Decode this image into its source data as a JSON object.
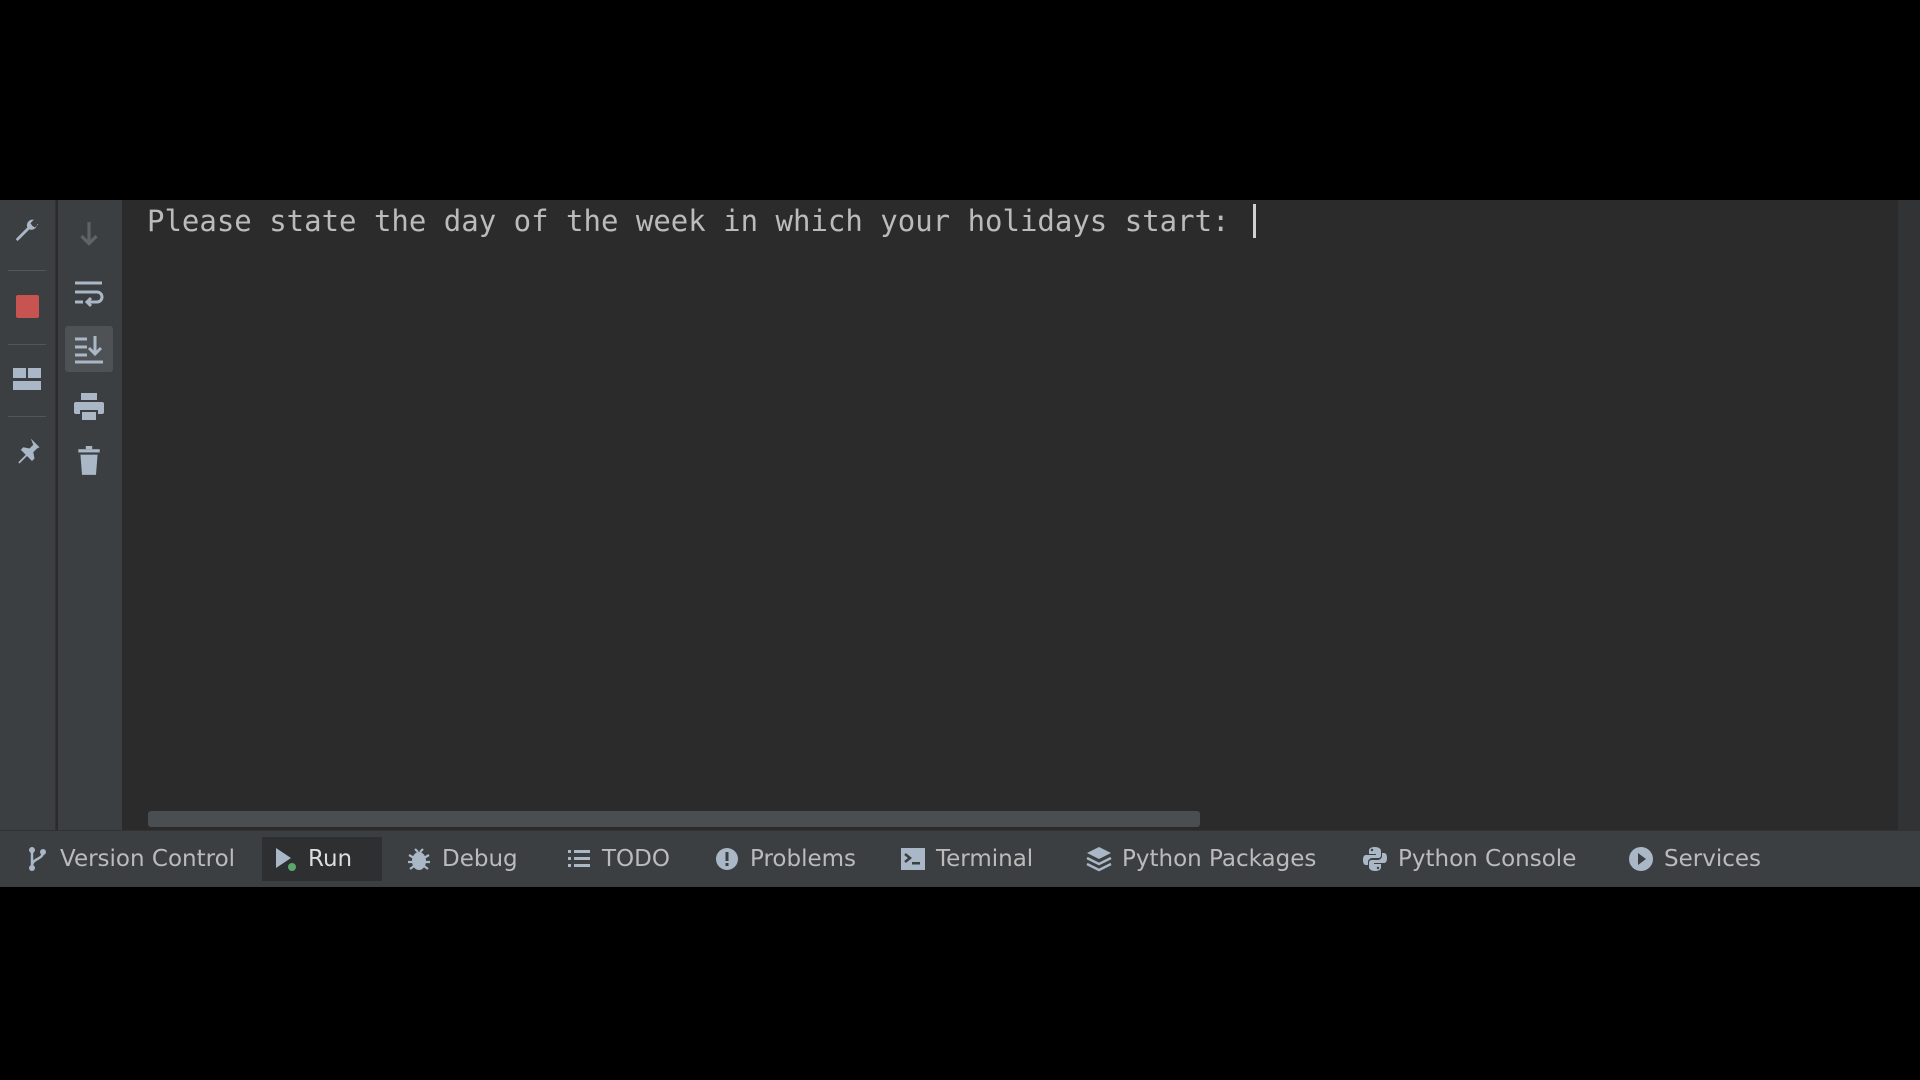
{
  "console": {
    "prompt_text": "Please state the day of the week in which your holidays start: "
  },
  "left_toolbar": {
    "icons": [
      "wrench-icon",
      "stop-icon",
      "layout-icon",
      "pin-icon"
    ],
    "stop_color": "#c75450"
  },
  "console_toolbar": {
    "icons": [
      "arrow-down-icon",
      "soft-wrap-icon",
      "scroll-to-end-icon",
      "print-icon",
      "trash-icon"
    ],
    "active": "scroll-to-end-icon"
  },
  "bottom_tabs": [
    {
      "label": "Version Control",
      "icon": "branch-icon",
      "active": false
    },
    {
      "label": "Run",
      "icon": "run-icon",
      "active": true
    },
    {
      "label": "Debug",
      "icon": "bug-icon",
      "active": false
    },
    {
      "label": "TODO",
      "icon": "list-icon",
      "active": false
    },
    {
      "label": "Problems",
      "icon": "exclamation-icon",
      "active": false
    },
    {
      "label": "Terminal",
      "icon": "terminal-icon",
      "active": false
    },
    {
      "label": "Python Packages",
      "icon": "layers-icon",
      "active": false
    },
    {
      "label": "Python Console",
      "icon": "python-icon",
      "active": false
    },
    {
      "label": "Services",
      "icon": "services-icon",
      "active": false
    }
  ],
  "colors": {
    "background": "#2b2b2b",
    "panel": "#3c3f41",
    "text": "#bbbbbb",
    "run_accent": "#59a869"
  }
}
